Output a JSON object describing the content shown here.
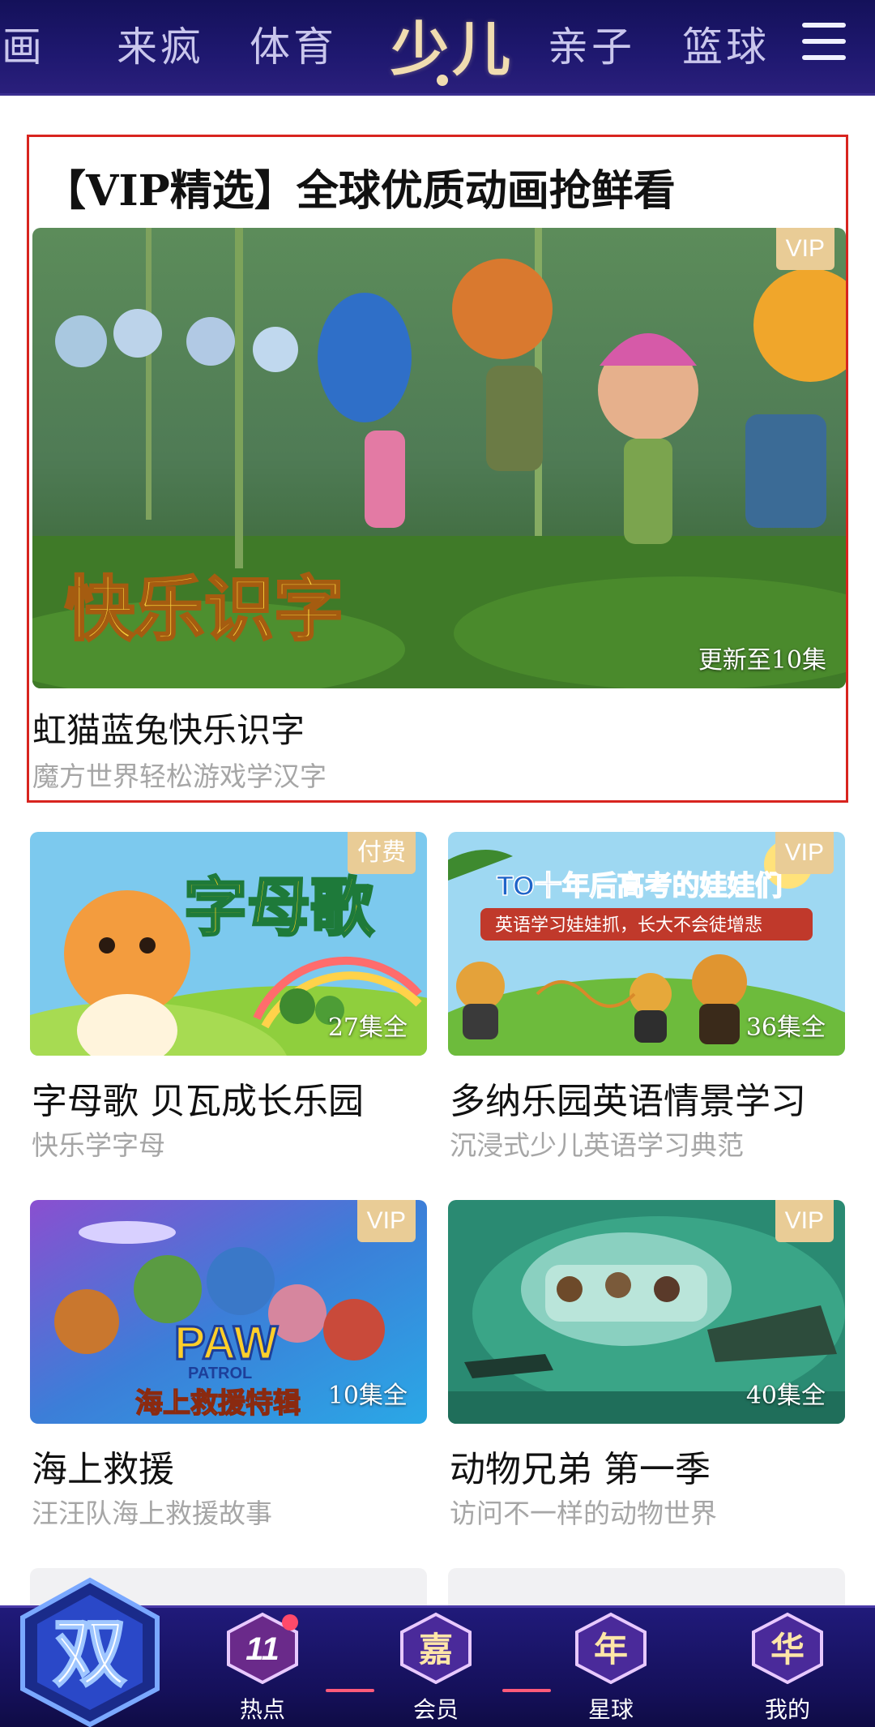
{
  "top_nav": {
    "tabs": [
      "漫画",
      "来疯",
      "体育",
      "少儿",
      "亲子",
      "篮球"
    ],
    "active_tab": "少儿"
  },
  "featured": {
    "title": "【VIP精选】全球优质动画抢鲜看",
    "badge": "VIP",
    "episodes": "更新至10集",
    "logo_text": "快乐识字",
    "name": "虹猫蓝兔快乐识字",
    "subtitle": "魔方世界轻松游戏学汉字"
  },
  "cards": [
    {
      "badge": "付费",
      "episodes": "27集全",
      "art_text": "字母歌",
      "name": "字母歌 贝瓦成长乐园",
      "subtitle": "快乐学字母"
    },
    {
      "badge": "VIP",
      "episodes": "36集全",
      "art_text": "TO十年后高考的娃娃们",
      "art_text2": "英语学习娃娃抓，长大不会徒增悲",
      "name": "多纳乐园英语情景学习",
      "subtitle": "沉浸式少儿英语学习典范"
    },
    {
      "badge": "VIP",
      "episodes": "10集全",
      "art_text": "PAW",
      "art_text2": "PATROL",
      "art_text3": "海上救援特辑",
      "name": "海上救援",
      "subtitle": "汪汪队海上救援故事"
    },
    {
      "badge": "VIP",
      "episodes": "40集全",
      "name": "动物兄弟 第一季",
      "subtitle": "访问不一样的动物世界"
    }
  ],
  "bottom_tabs": {
    "home_glyph": "双",
    "items": [
      {
        "glyph": "11",
        "label": "热点"
      },
      {
        "glyph": "嘉",
        "label": "会员"
      },
      {
        "glyph": "年",
        "label": "星球"
      },
      {
        "glyph": "华",
        "label": "我的"
      }
    ]
  },
  "colors": {
    "nav_bg": "#1b1566",
    "active_tab": "#f0dcb0",
    "badge_bg": "#e9cc96",
    "featured_border": "#d8241f"
  }
}
